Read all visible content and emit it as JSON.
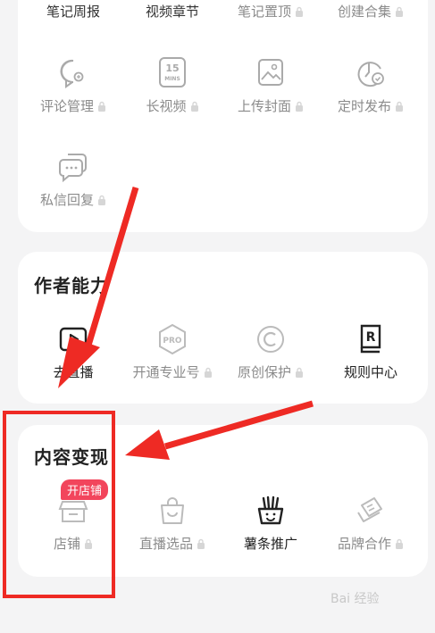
{
  "section1": {
    "row0": [
      {
        "label": "笔记周报",
        "locked": false
      },
      {
        "label": "视频章节",
        "locked": false
      },
      {
        "label": "笔记置顶",
        "locked": true
      },
      {
        "label": "创建合集",
        "locked": true
      }
    ],
    "row1": [
      {
        "label": "评论管理",
        "locked": true,
        "icon": "comment-manage-icon"
      },
      {
        "label": "长视频",
        "locked": true,
        "icon": "long-video-icon",
        "icon_text": "15\nMINS"
      },
      {
        "label": "上传封面",
        "locked": true,
        "icon": "upload-cover-icon"
      },
      {
        "label": "定时发布",
        "locked": true,
        "icon": "scheduled-publish-icon"
      }
    ],
    "row2": [
      {
        "label": "私信回复",
        "locked": true,
        "icon": "message-reply-icon"
      }
    ]
  },
  "section2": {
    "title": "作者能力",
    "items": [
      {
        "label": "去直播",
        "locked": false,
        "icon": "live-stream-icon"
      },
      {
        "label": "开通专业号",
        "locked": true,
        "icon": "pro-account-icon",
        "icon_text": "PRO"
      },
      {
        "label": "原创保护",
        "locked": true,
        "icon": "copyright-icon"
      },
      {
        "label": "规则中心",
        "locked": false,
        "icon": "rules-center-icon"
      }
    ]
  },
  "section3": {
    "title": "内容变现",
    "badge": "开店铺",
    "items": [
      {
        "label": "店铺",
        "locked": true,
        "icon": "shop-icon"
      },
      {
        "label": "直播选品",
        "locked": true,
        "icon": "live-select-icon"
      },
      {
        "label": "薯条推广",
        "locked": false,
        "icon": "fries-promo-icon"
      },
      {
        "label": "品牌合作",
        "locked": true,
        "icon": "brand-coop-icon"
      }
    ]
  },
  "watermark": "Bai 经验",
  "colors": {
    "accent": "#ee2a24",
    "badge": "#f2455c",
    "muted": "#8b8b8b"
  }
}
